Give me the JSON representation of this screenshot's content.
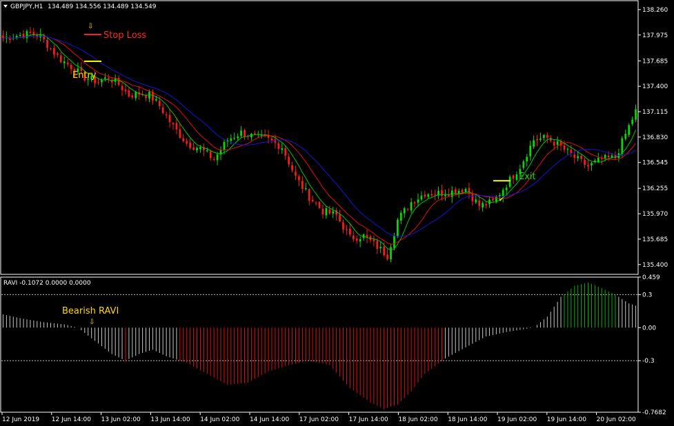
{
  "chart_data": [
    {
      "type": "candlestick",
      "title": "GBPJPY,H1",
      "ohlc_header": "134.489 134.556 134.489 134.549",
      "y_ticks": [
        "138.260",
        "137.975",
        "137.685",
        "137.400",
        "137.115",
        "136.830",
        "136.545",
        "136.255",
        "135.970",
        "135.685",
        "135.400"
      ],
      "ylim": [
        135.29,
        138.36
      ],
      "bull_color": "#00e000",
      "bear_color": "#ff1a1a",
      "ma_colors": {
        "fast": "#00c800",
        "mid": "#e01010",
        "slow": "#1414d8"
      },
      "annotations": {
        "stop_loss": "Stop Loss",
        "entry": "Entry",
        "exit": "Exit",
        "stop_loss_price": 137.98,
        "entry_price": 137.68,
        "exit_price": 136.34
      },
      "anchors": [
        [
          0,
          137.94
        ],
        [
          4,
          137.97
        ],
        [
          8,
          137.99
        ],
        [
          11,
          137.96
        ],
        [
          14,
          137.82
        ],
        [
          17,
          137.7
        ],
        [
          20,
          137.62
        ],
        [
          24,
          137.5
        ],
        [
          28,
          137.45
        ],
        [
          31,
          137.5
        ],
        [
          34,
          137.42
        ],
        [
          37,
          137.3
        ],
        [
          40,
          137.32
        ],
        [
          43,
          137.3
        ],
        [
          46,
          137.18
        ],
        [
          50,
          136.95
        ],
        [
          54,
          136.76
        ],
        [
          58,
          136.7
        ],
        [
          62,
          136.58
        ],
        [
          66,
          136.8
        ],
        [
          70,
          136.88
        ],
        [
          74,
          136.83
        ],
        [
          78,
          136.8
        ],
        [
          82,
          136.72
        ],
        [
          86,
          136.38
        ],
        [
          90,
          136.16
        ],
        [
          94,
          136.0
        ],
        [
          98,
          135.95
        ],
        [
          102,
          135.7
        ],
        [
          106,
          135.72
        ],
        [
          110,
          135.6
        ],
        [
          113,
          135.5
        ],
        [
          116,
          135.9
        ],
        [
          120,
          136.1
        ],
        [
          124,
          136.2
        ],
        [
          128,
          136.2
        ],
        [
          132,
          136.22
        ],
        [
          136,
          136.25
        ],
        [
          140,
          136.06
        ],
        [
          144,
          136.1
        ],
        [
          148,
          136.3
        ],
        [
          152,
          136.5
        ],
        [
          156,
          136.8
        ],
        [
          160,
          136.82
        ],
        [
          164,
          136.72
        ],
        [
          168,
          136.6
        ],
        [
          172,
          136.5
        ],
        [
          176,
          136.58
        ],
        [
          180,
          136.6
        ],
        [
          184,
          136.95
        ],
        [
          186,
          137.12
        ]
      ]
    },
    {
      "type": "histogram",
      "title": "RAVI -0.1072 0.0000 0.0000",
      "y_ticks": [
        "0.459",
        "0.3",
        "0.00",
        "-0.3",
        "-0.7682"
      ],
      "ylim": [
        -0.7682,
        0.459
      ],
      "levels": [
        0.3,
        -0.3
      ],
      "colors": {
        "neutral": "#c8c8c8",
        "bearish": "#e01010",
        "bullish": "#00b400"
      },
      "annotation": "Bearish RAVI",
      "anchors": [
        [
          0,
          0.12
        ],
        [
          6,
          0.08
        ],
        [
          12,
          0.05
        ],
        [
          18,
          0.03
        ],
        [
          22,
          0.0
        ],
        [
          27,
          -0.12
        ],
        [
          32,
          -0.24
        ],
        [
          36,
          -0.3
        ],
        [
          40,
          -0.24
        ],
        [
          44,
          -0.2
        ],
        [
          48,
          -0.26
        ],
        [
          54,
          -0.32
        ],
        [
          60,
          -0.42
        ],
        [
          66,
          -0.52
        ],
        [
          72,
          -0.5
        ],
        [
          78,
          -0.4
        ],
        [
          84,
          -0.34
        ],
        [
          90,
          -0.3
        ],
        [
          96,
          -0.34
        ],
        [
          102,
          -0.55
        ],
        [
          108,
          -0.68
        ],
        [
          112,
          -0.74
        ],
        [
          116,
          -0.7
        ],
        [
          120,
          -0.58
        ],
        [
          124,
          -0.42
        ],
        [
          130,
          -0.28
        ],
        [
          136,
          -0.18
        ],
        [
          142,
          -0.08
        ],
        [
          148,
          -0.04
        ],
        [
          152,
          -0.02
        ],
        [
          156,
          0.0
        ],
        [
          160,
          0.1
        ],
        [
          164,
          0.28
        ],
        [
          168,
          0.38
        ],
        [
          172,
          0.41
        ],
        [
          176,
          0.36
        ],
        [
          180,
          0.3
        ],
        [
          184,
          0.22
        ],
        [
          186,
          0.2
        ]
      ]
    }
  ],
  "x_ticks": [
    "12 Jun 2019",
    "12 Jun 14:00",
    "13 Jun 02:00",
    "13 Jun 14:00",
    "14 Jun 02:00",
    "14 Jun 14:00",
    "17 Jun 02:00",
    "17 Jun 14:00",
    "18 Jun 02:00",
    "18 Jun 14:00",
    "19 Jun 02:00",
    "19 Jun 14:00",
    "20 Jun 02:00"
  ],
  "colors": {
    "background": "#000000",
    "frame": "#ffffff",
    "text": "#ffffff",
    "annotation_red": "#ff2a1a",
    "annotation_yellow": "#ffd700",
    "annotation_green": "#00e000",
    "entry_line": "#ffff00"
  }
}
